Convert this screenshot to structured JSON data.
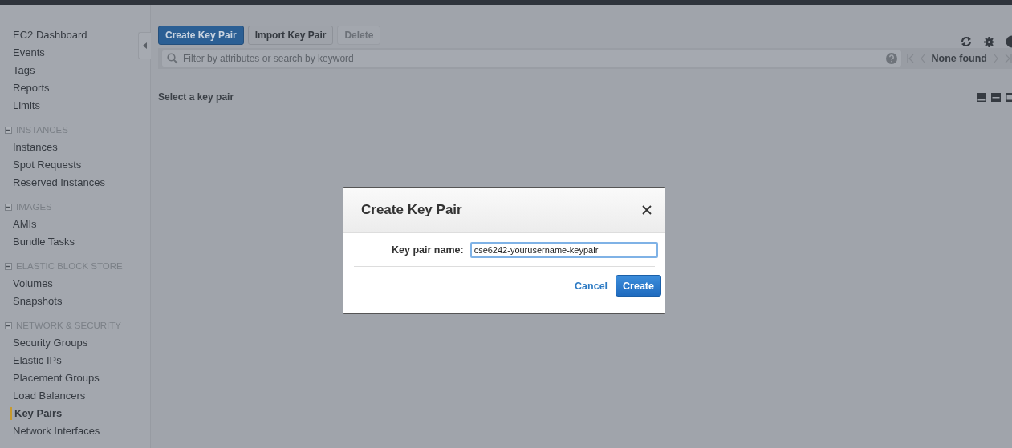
{
  "sidebar": {
    "top_items": [
      {
        "label": "EC2 Dashboard",
        "selected": false
      },
      {
        "label": "Events",
        "selected": false
      },
      {
        "label": "Tags",
        "selected": false
      },
      {
        "label": "Reports",
        "selected": false
      },
      {
        "label": "Limits",
        "selected": false
      }
    ],
    "sections": [
      {
        "title": "INSTANCES",
        "expanded": true,
        "items": [
          {
            "label": "Instances",
            "selected": false
          },
          {
            "label": "Spot Requests",
            "selected": false
          },
          {
            "label": "Reserved Instances",
            "selected": false
          }
        ]
      },
      {
        "title": "IMAGES",
        "expanded": true,
        "items": [
          {
            "label": "AMIs",
            "selected": false
          },
          {
            "label": "Bundle Tasks",
            "selected": false
          }
        ]
      },
      {
        "title": "ELASTIC BLOCK STORE",
        "expanded": true,
        "items": [
          {
            "label": "Volumes",
            "selected": false
          },
          {
            "label": "Snapshots",
            "selected": false
          }
        ]
      },
      {
        "title": "NETWORK & SECURITY",
        "expanded": true,
        "items": [
          {
            "label": "Security Groups",
            "selected": false
          },
          {
            "label": "Elastic IPs",
            "selected": false
          },
          {
            "label": "Placement Groups",
            "selected": false
          },
          {
            "label": "Load Balancers",
            "selected": false
          },
          {
            "label": "Key Pairs",
            "selected": true
          },
          {
            "label": "Network Interfaces",
            "selected": false
          }
        ]
      }
    ]
  },
  "toolbar": {
    "buttons": [
      {
        "label": "Create Key Pair",
        "kind": "primary",
        "disabled": false
      },
      {
        "label": "Import Key Pair",
        "kind": "default",
        "disabled": false
      },
      {
        "label": "Delete",
        "kind": "default",
        "disabled": true
      }
    ]
  },
  "search": {
    "placeholder": "Filter by attributes or search by keyword"
  },
  "pager": {
    "status": "None found"
  },
  "detail": {
    "title": "Select a key pair"
  },
  "dialog": {
    "title": "Create Key Pair",
    "field_label": "Key pair name:",
    "field_value": "cse6242-yourusername-keypair",
    "cancel": "Cancel",
    "confirm": "Create"
  }
}
